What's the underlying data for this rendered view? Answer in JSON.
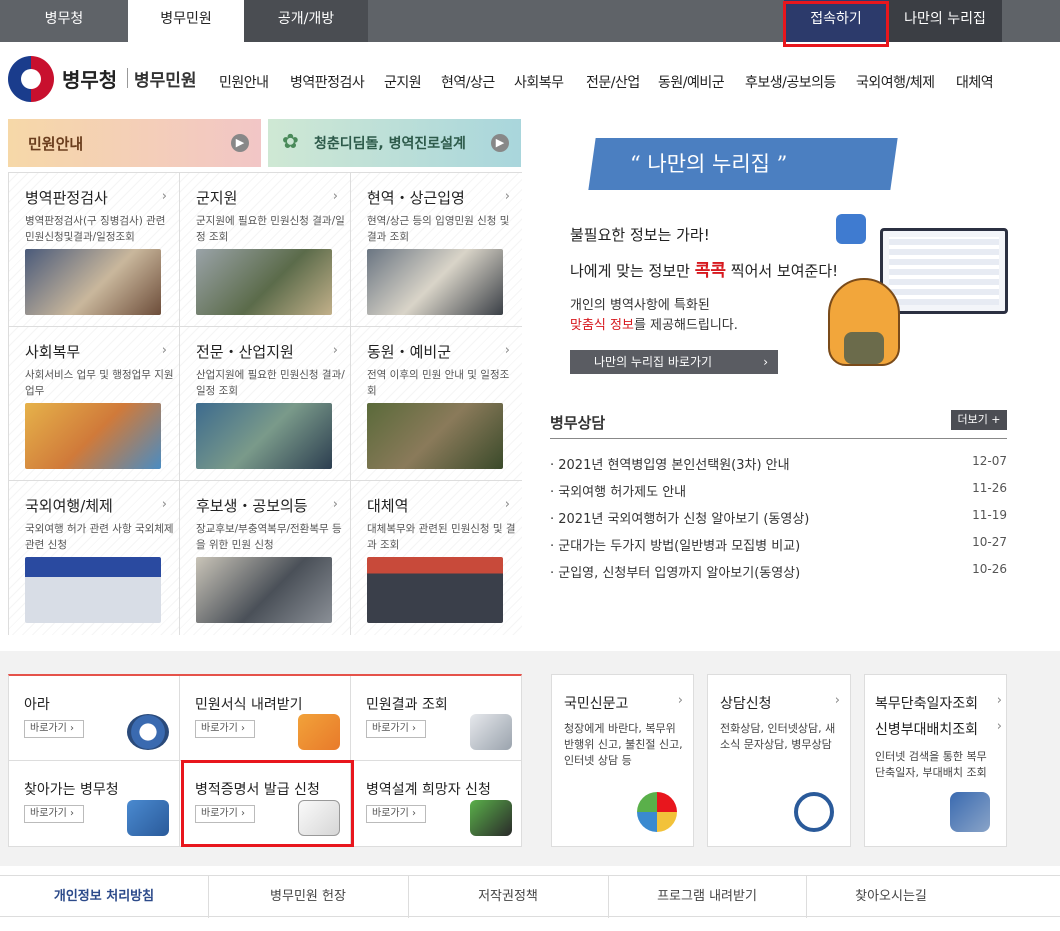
{
  "top_tabs": [
    {
      "label": "병무청"
    },
    {
      "label": "병무민원"
    },
    {
      "label": "공개/개방"
    },
    {
      "label": "접속하기"
    },
    {
      "label": "나만의 누리집"
    }
  ],
  "brand": {
    "name": "병무청",
    "sub": "병무민원"
  },
  "nav": [
    "민원안내",
    "병역판정검사",
    "군지원",
    "현역/상근",
    "사회복무",
    "전문/산업",
    "동원/예비군",
    "후보생/공보의등",
    "국외여행/체제",
    "대체역"
  ],
  "banners": {
    "left": "민원안내",
    "right": "청춘디딤돌, 병역진로설계"
  },
  "cards": [
    {
      "title": "병역판정검사",
      "desc": "병역판정검사(구 징병검사) 관련 민원신청및결과/일정조회"
    },
    {
      "title": "군지원",
      "desc": "군지원에 필요한 민원신청 결과/일정 조회"
    },
    {
      "title": "현역・상근입영",
      "desc": "현역/상근 등의 입영민원 신청 및 결과 조회"
    },
    {
      "title": "사회복무",
      "desc": "사회서비스 업무 및 행정업무 지원 업무"
    },
    {
      "title": "전문・산업지원",
      "desc": "산업지원에 필요한 민원신청 결과/일정 조회"
    },
    {
      "title": "동원・예비군",
      "desc": "전역 이후의 민원 안내 및 일정조회"
    },
    {
      "title": "국외여행/체제",
      "desc": "국외여행 허가 관련 사항 국외체제 관련 신청"
    },
    {
      "title": "후보생・공보의등",
      "desc": "장교후보/부충역복무/전환복무 등을 위한 민원 신청"
    },
    {
      "title": "대체역",
      "desc": "대체복무와 관련된 민원신청 및 결과 조회"
    }
  ],
  "nuri": {
    "ribbon": "“ 나만의 누리집 ”",
    "line1": "불필요한 정보는 가라!",
    "line2_pre": "나에게 맞는 정보만 ",
    "line2_hl": "콕콕",
    "line2_post": " 찍어서 보여준다!",
    "line3": "개인의 병역사항에 특화된",
    "line4_hl": "맞춤식 정보",
    "line4_post": "를 제공해드립니다.",
    "button": "나만의 누리집 바로가기",
    "button_arrow": "›",
    "bubble_icon": "calendar-bubble-icon"
  },
  "consult": {
    "title": "병무상담",
    "more": "더보기 +",
    "items": [
      {
        "text": "· 2021년 현역병입영 본인선택원(3차) 안내",
        "date": "12-07"
      },
      {
        "text": "· 국외여행 허가제도 안내",
        "date": "11-26"
      },
      {
        "text": "· 2021년 국외여행허가 신청 알아보기 (동영상)",
        "date": "11-19"
      },
      {
        "text": "· 군대가는 두가지 방법(일반병과 모집병 비교)",
        "date": "10-27"
      },
      {
        "text": "· 군입영, 신청부터 입영까지 알아보기(동영상)",
        "date": "10-26"
      }
    ]
  },
  "quick": [
    {
      "title": "아라",
      "btn": "바로가기 ›"
    },
    {
      "title": "민원서식 내려받기",
      "btn": "바로가기 ›"
    },
    {
      "title": "민원결과 조회",
      "btn": "바로가기 ›"
    },
    {
      "title": "찾아가는 병무청",
      "btn": "바로가기 ›"
    },
    {
      "title": "병적증명서 발급 신청",
      "btn": "바로가기 ›"
    },
    {
      "title": "병역설계 희망자 신청",
      "btn": "바로가기 ›"
    }
  ],
  "side_boxes": [
    {
      "title": "국민신문고",
      "desc": "청장에게 바란다, 복무위반행위 신고, 불친절 신고, 인터넷 상담 등"
    },
    {
      "title": "상담신청",
      "desc": "전화상담, 인터넷상담, 새 소식 문자상담, 병무상담"
    },
    {
      "title": "복무단축일자조회",
      "title2": "신병부대배치조회",
      "desc": "인터넷 검색을 통한 복무단축일자, 부대배치 조회"
    }
  ],
  "footer": [
    "개인정보 처리방침",
    "병무민원 헌장",
    "저작권정책",
    "프로그램 내려받기",
    "찾아오시는길"
  ],
  "colors": {
    "accent_red": "#e8161d",
    "top_bar": "#5f6368",
    "navy": "#2c3a6b"
  }
}
